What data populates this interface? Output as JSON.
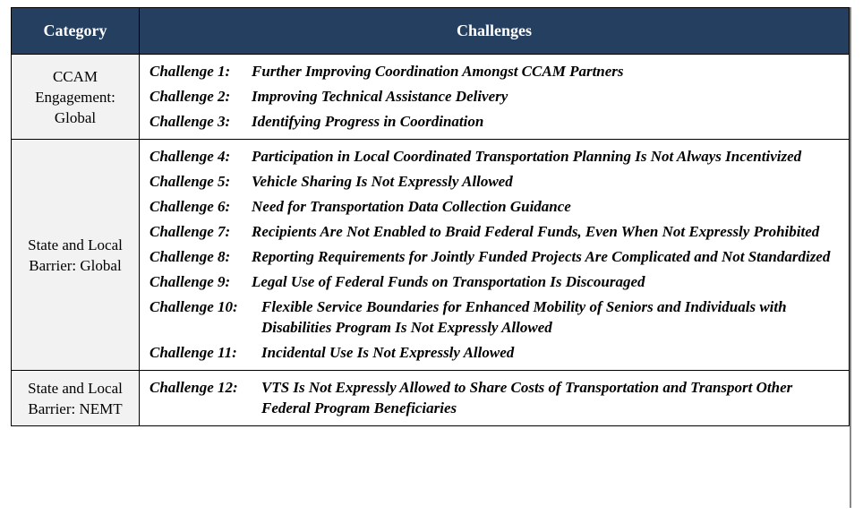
{
  "table": {
    "headers": {
      "category": "Category",
      "challenges": "Challenges"
    },
    "colors": {
      "header_bg": "#243F60",
      "category_bg": "#F2F2F2"
    },
    "rows": [
      {
        "category": "CCAM Engagement: Global",
        "challenges": [
          {
            "label": "Challenge 1:",
            "text": "Further Improving Coordination Amongst CCAM Partners"
          },
          {
            "label": "Challenge 2:",
            "text": "Improving Technical Assistance Delivery"
          },
          {
            "label": "Challenge 3:",
            "text": "Identifying Progress in Coordination"
          }
        ]
      },
      {
        "category": "State and Local Barrier:  Global",
        "challenges": [
          {
            "label": "Challenge 4:",
            "text": "Participation in Local Coordinated Transportation Planning Is Not Always Incentivized"
          },
          {
            "label": "Challenge 5:",
            "text": "Vehicle Sharing Is Not Expressly Allowed"
          },
          {
            "label": "Challenge 6:",
            "text": "Need for Transportation Data Collection Guidance"
          },
          {
            "label": "Challenge 7:",
            "text": "Recipients Are Not Enabled to Braid Federal Funds, Even When Not Expressly Prohibited"
          },
          {
            "label": "Challenge 8:",
            "text": "Reporting Requirements for Jointly Funded Projects Are Complicated and Not Standardized"
          },
          {
            "label": "Challenge 9:",
            "text": "Legal Use of Federal Funds on Transportation Is Discouraged"
          },
          {
            "label": "Challenge 10:",
            "text": "Flexible Service Boundaries for Enhanced Mobility of Seniors and Individuals with Disabilities Program Is Not Expressly Allowed"
          },
          {
            "label": "Challenge 11:",
            "text": "Incidental Use Is Not Expressly Allowed"
          }
        ]
      },
      {
        "category": "State and Local Barrier:  NEMT",
        "challenges": [
          {
            "label": "Challenge 12:",
            "text": "VTS Is Not Expressly Allowed to Share Costs of Transportation and Transport Other Federal Program Beneficiaries"
          }
        ]
      }
    ]
  }
}
